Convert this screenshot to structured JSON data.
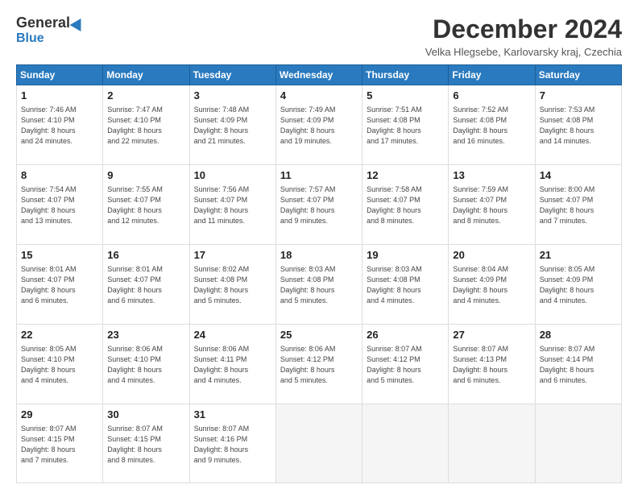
{
  "logo": {
    "general": "General",
    "blue": "Blue"
  },
  "title": "December 2024",
  "subtitle": "Velka Hlegsebe, Karlovarsky kraj, Czechia",
  "days_header": [
    "Sunday",
    "Monday",
    "Tuesday",
    "Wednesday",
    "Thursday",
    "Friday",
    "Saturday"
  ],
  "weeks": [
    [
      {
        "num": "1",
        "info": "Sunrise: 7:46 AM\nSunset: 4:10 PM\nDaylight: 8 hours\nand 24 minutes."
      },
      {
        "num": "2",
        "info": "Sunrise: 7:47 AM\nSunset: 4:10 PM\nDaylight: 8 hours\nand 22 minutes."
      },
      {
        "num": "3",
        "info": "Sunrise: 7:48 AM\nSunset: 4:09 PM\nDaylight: 8 hours\nand 21 minutes."
      },
      {
        "num": "4",
        "info": "Sunrise: 7:49 AM\nSunset: 4:09 PM\nDaylight: 8 hours\nand 19 minutes."
      },
      {
        "num": "5",
        "info": "Sunrise: 7:51 AM\nSunset: 4:08 PM\nDaylight: 8 hours\nand 17 minutes."
      },
      {
        "num": "6",
        "info": "Sunrise: 7:52 AM\nSunset: 4:08 PM\nDaylight: 8 hours\nand 16 minutes."
      },
      {
        "num": "7",
        "info": "Sunrise: 7:53 AM\nSunset: 4:08 PM\nDaylight: 8 hours\nand 14 minutes."
      }
    ],
    [
      {
        "num": "8",
        "info": "Sunrise: 7:54 AM\nSunset: 4:07 PM\nDaylight: 8 hours\nand 13 minutes."
      },
      {
        "num": "9",
        "info": "Sunrise: 7:55 AM\nSunset: 4:07 PM\nDaylight: 8 hours\nand 12 minutes."
      },
      {
        "num": "10",
        "info": "Sunrise: 7:56 AM\nSunset: 4:07 PM\nDaylight: 8 hours\nand 11 minutes."
      },
      {
        "num": "11",
        "info": "Sunrise: 7:57 AM\nSunset: 4:07 PM\nDaylight: 8 hours\nand 9 minutes."
      },
      {
        "num": "12",
        "info": "Sunrise: 7:58 AM\nSunset: 4:07 PM\nDaylight: 8 hours\nand 8 minutes."
      },
      {
        "num": "13",
        "info": "Sunrise: 7:59 AM\nSunset: 4:07 PM\nDaylight: 8 hours\nand 8 minutes."
      },
      {
        "num": "14",
        "info": "Sunrise: 8:00 AM\nSunset: 4:07 PM\nDaylight: 8 hours\nand 7 minutes."
      }
    ],
    [
      {
        "num": "15",
        "info": "Sunrise: 8:01 AM\nSunset: 4:07 PM\nDaylight: 8 hours\nand 6 minutes."
      },
      {
        "num": "16",
        "info": "Sunrise: 8:01 AM\nSunset: 4:07 PM\nDaylight: 8 hours\nand 6 minutes."
      },
      {
        "num": "17",
        "info": "Sunrise: 8:02 AM\nSunset: 4:08 PM\nDaylight: 8 hours\nand 5 minutes."
      },
      {
        "num": "18",
        "info": "Sunrise: 8:03 AM\nSunset: 4:08 PM\nDaylight: 8 hours\nand 5 minutes."
      },
      {
        "num": "19",
        "info": "Sunrise: 8:03 AM\nSunset: 4:08 PM\nDaylight: 8 hours\nand 4 minutes."
      },
      {
        "num": "20",
        "info": "Sunrise: 8:04 AM\nSunset: 4:09 PM\nDaylight: 8 hours\nand 4 minutes."
      },
      {
        "num": "21",
        "info": "Sunrise: 8:05 AM\nSunset: 4:09 PM\nDaylight: 8 hours\nand 4 minutes."
      }
    ],
    [
      {
        "num": "22",
        "info": "Sunrise: 8:05 AM\nSunset: 4:10 PM\nDaylight: 8 hours\nand 4 minutes."
      },
      {
        "num": "23",
        "info": "Sunrise: 8:06 AM\nSunset: 4:10 PM\nDaylight: 8 hours\nand 4 minutes."
      },
      {
        "num": "24",
        "info": "Sunrise: 8:06 AM\nSunset: 4:11 PM\nDaylight: 8 hours\nand 4 minutes."
      },
      {
        "num": "25",
        "info": "Sunrise: 8:06 AM\nSunset: 4:12 PM\nDaylight: 8 hours\nand 5 minutes."
      },
      {
        "num": "26",
        "info": "Sunrise: 8:07 AM\nSunset: 4:12 PM\nDaylight: 8 hours\nand 5 minutes."
      },
      {
        "num": "27",
        "info": "Sunrise: 8:07 AM\nSunset: 4:13 PM\nDaylight: 8 hours\nand 6 minutes."
      },
      {
        "num": "28",
        "info": "Sunrise: 8:07 AM\nSunset: 4:14 PM\nDaylight: 8 hours\nand 6 minutes."
      }
    ],
    [
      {
        "num": "29",
        "info": "Sunrise: 8:07 AM\nSunset: 4:15 PM\nDaylight: 8 hours\nand 7 minutes."
      },
      {
        "num": "30",
        "info": "Sunrise: 8:07 AM\nSunset: 4:15 PM\nDaylight: 8 hours\nand 8 minutes."
      },
      {
        "num": "31",
        "info": "Sunrise: 8:07 AM\nSunset: 4:16 PM\nDaylight: 8 hours\nand 9 minutes."
      },
      null,
      null,
      null,
      null
    ]
  ]
}
